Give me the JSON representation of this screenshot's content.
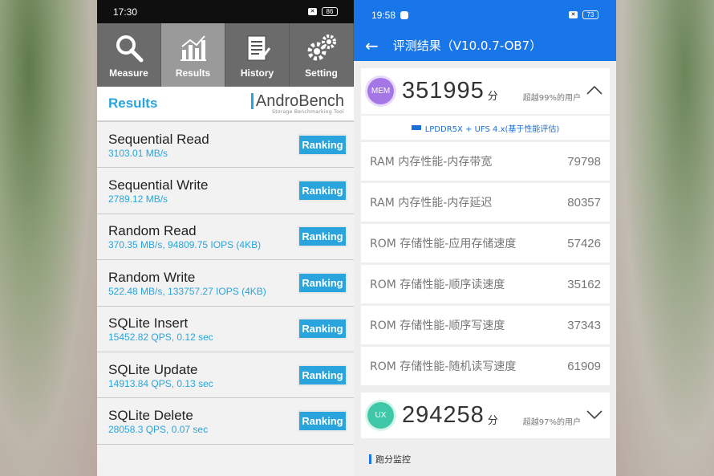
{
  "androbench": {
    "status": {
      "time": "17:30",
      "battery": "86"
    },
    "tabs": [
      {
        "label": "Measure",
        "icon": "search-icon"
      },
      {
        "label": "Results",
        "icon": "bar-chart-icon"
      },
      {
        "label": "History",
        "icon": "document-icon"
      },
      {
        "label": "Setting",
        "icon": "gear-icon"
      }
    ],
    "results_title": "Results",
    "logo": {
      "main": "AndroBench",
      "sub": "Storage Benchmarking Tool"
    },
    "ranking_label": "Ranking",
    "rows": [
      {
        "name": "Sequential Read",
        "value": "3103.01 MB/s"
      },
      {
        "name": "Sequential Write",
        "value": "2789.12 MB/s"
      },
      {
        "name": "Random Read",
        "value": "370.35 MB/s, 94809.75 IOPS (4KB)"
      },
      {
        "name": "Random Write",
        "value": "522.48 MB/s, 133757.27 IOPS (4KB)"
      },
      {
        "name": "SQLite Insert",
        "value": "15452.82 QPS, 0.12 sec"
      },
      {
        "name": "SQLite Update",
        "value": "14913.84 QPS, 0.13 sec"
      },
      {
        "name": "SQLite Delete",
        "value": "28058.3 QPS, 0.07 sec"
      }
    ],
    "accent_color": "#2aa4dc"
  },
  "antutu": {
    "status": {
      "time": "19:58",
      "battery": "73"
    },
    "header_title": "评测结果（V10.0.7-OB7）",
    "mem": {
      "badge": "MEM",
      "score": "351995",
      "unit": "分",
      "percent": "超越99%的用户",
      "config": "LPDDR5X + UFS 4.x(基于性能评估)"
    },
    "rows": [
      {
        "label": "RAM 内存性能-内存带宽",
        "value": "79798"
      },
      {
        "label": "RAM 内存性能-内存延迟",
        "value": "80357"
      },
      {
        "label": "ROM 存储性能-应用存储速度",
        "value": "57426"
      },
      {
        "label": "ROM 存储性能-顺序读速度",
        "value": "35162"
      },
      {
        "label": "ROM 存储性能-顺序写速度",
        "value": "37343"
      },
      {
        "label": "ROM 存储性能-随机读写速度",
        "value": "61909"
      }
    ],
    "ux": {
      "badge": "UX",
      "score": "294258",
      "unit": "分",
      "percent": "超越97%的用户"
    },
    "monitor_label": "跑分监控",
    "accent_color": "#1976e8"
  }
}
